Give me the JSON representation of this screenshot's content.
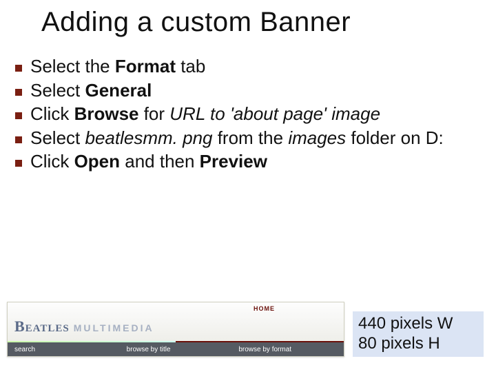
{
  "title": "Adding a custom Banner",
  "bullets": [
    {
      "pre": "Select the ",
      "b1": "Format",
      "post1": " tab"
    },
    {
      "pre": "Select ",
      "b1": "General"
    },
    {
      "pre": "Click ",
      "b1": "Browse",
      "post1": " for ",
      "i1": "URL to 'about page' image"
    },
    {
      "pre": "Select ",
      "i1": "beatlesmm. png",
      "post1": " from the ",
      "i2": "images",
      "post2": " folder on D:"
    },
    {
      "pre": "Click ",
      "b1": "Open",
      "post1": " and then ",
      "b2": "Preview"
    }
  ],
  "banner": {
    "logo_a": "Beatles",
    "logo_b": "multimedia",
    "home": "HOME",
    "nav": [
      "search",
      "browse by title",
      "browse by format"
    ]
  },
  "dims": {
    "w": "440 pixels W",
    "h": "80 pixels H"
  }
}
